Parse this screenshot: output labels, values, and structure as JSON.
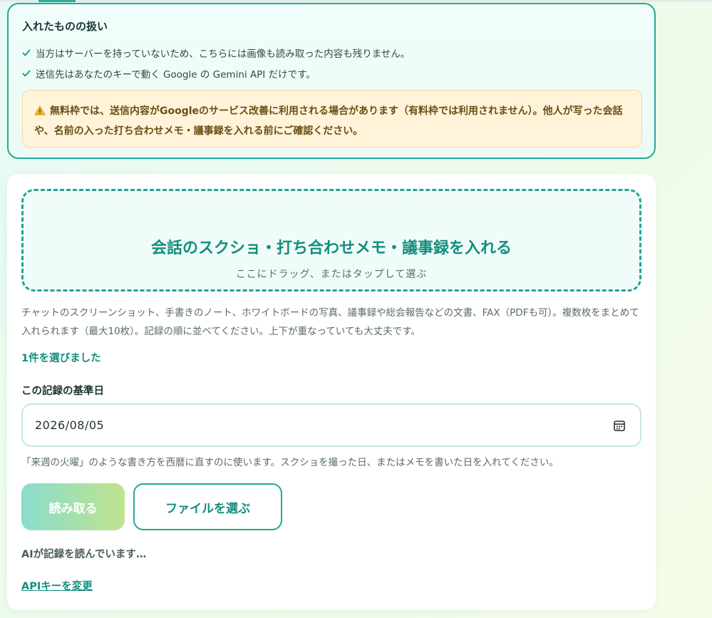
{
  "privacy": {
    "title": "入れたものの扱い",
    "bullets": [
      "当方はサーバーを持っていないため、こちらには画像も読み取った内容も残りません。",
      "送信先はあなたのキーで動く Google の Gemini API だけです。"
    ],
    "warning": "無料枠では、送信内容がGoogleのサービス改善に利用される場合があります（有料枠では利用されません）。他人が写った会話や、名前の入った打ち合わせメモ・議事録を入れる前にご確認ください。"
  },
  "dropzone": {
    "title": "会話のスクショ・打ち合わせメモ・議事録を入れる",
    "subtitle": "ここにドラッグ、またはタップして選ぶ"
  },
  "help_text": "チャットのスクリーンショット、手書きのノート、ホワイトボードの写真、議事録や総会報告などの文書、FAX（PDFも可）。複数枚をまとめて入れられます（最大10枚）。記録の順に並べてください。上下が重なっていても大丈夫です。",
  "selected_count": "1件を選びました",
  "date": {
    "label": "この記録の基準日",
    "value": "2026/08/05",
    "help": "「来週の火曜」のような書き方を西暦に直すのに使います。スクショを撮った日、またはメモを書いた日を入れてください。"
  },
  "buttons": {
    "read": "読み取る",
    "choose_file": "ファイルを選ぶ"
  },
  "status": "AIが記録を読んでいます…",
  "api_link": "APIキーを変更",
  "colors": {
    "accent": "#23a594",
    "accent_text": "#138e7f",
    "warning_bg": "#fff3da",
    "warning_text": "#6a4e13"
  },
  "icons": {
    "check": "check-icon",
    "warning": "warning-icon",
    "calendar": "calendar-icon"
  }
}
